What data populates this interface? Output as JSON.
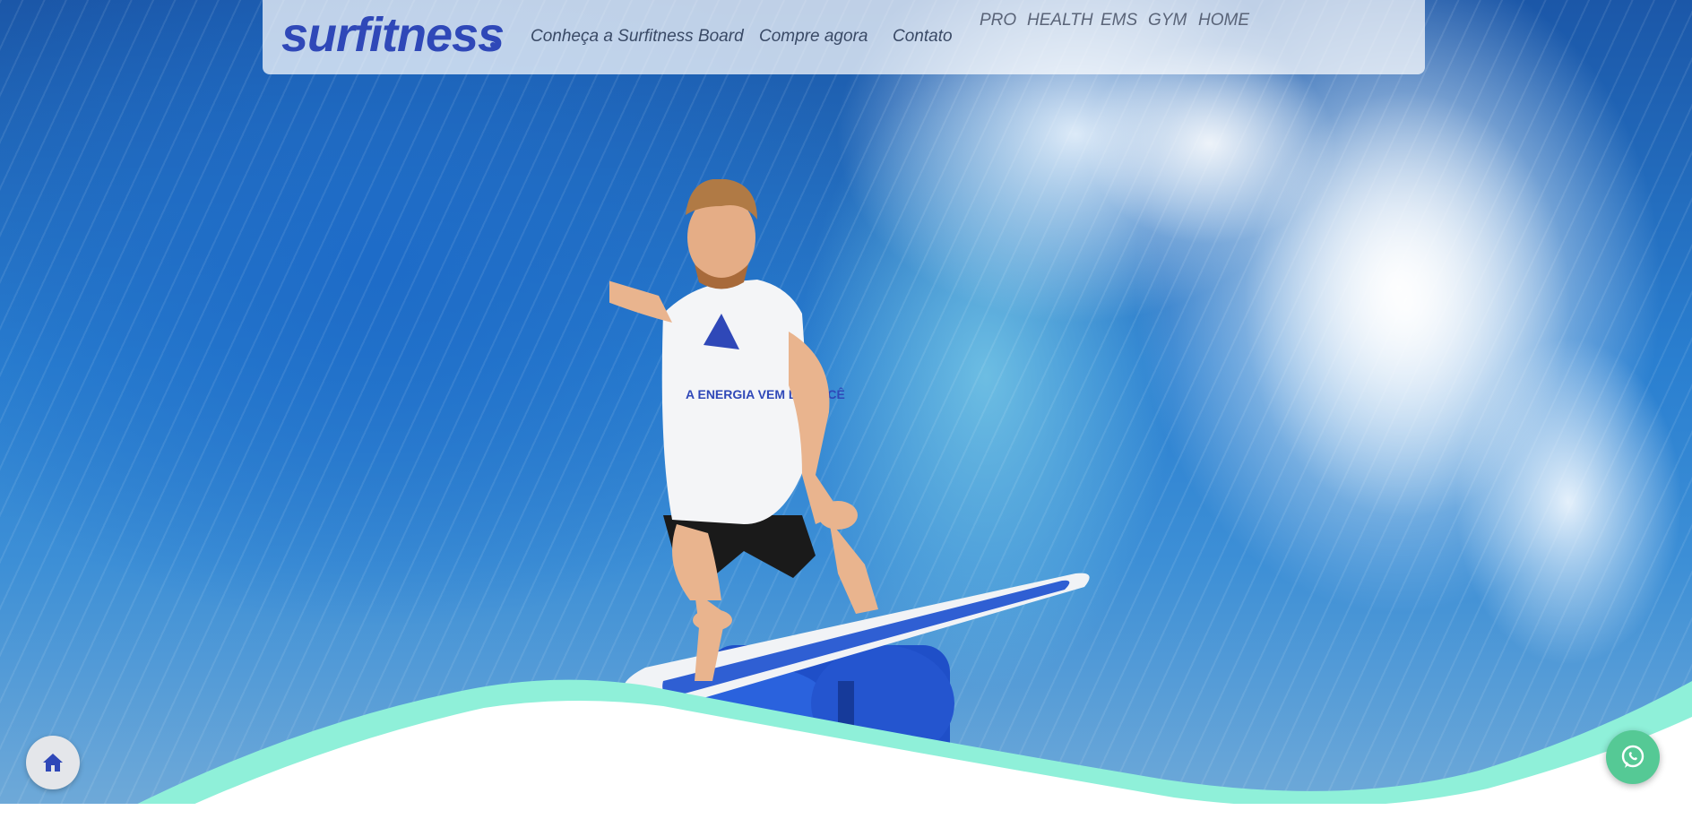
{
  "nav": {
    "logo_text": "surfitness",
    "links": [
      "Conheça a Surfitness Board",
      "Compre agora",
      "Contato"
    ],
    "top_links": [
      "PRO",
      "HEALTH",
      "EMS",
      "GYM",
      "HOME"
    ]
  },
  "surfer": {
    "shirt_text": "A ENERGIA VEM DE VOCÊ"
  },
  "floating": {
    "home_icon": "home-icon",
    "whatsapp_icon": "whatsapp-icon"
  },
  "colors": {
    "brand": "#2f48b8",
    "accent_mint": "#8ff0d9",
    "whatsapp": "#55c995",
    "board_blue": "#1f4fc8"
  }
}
